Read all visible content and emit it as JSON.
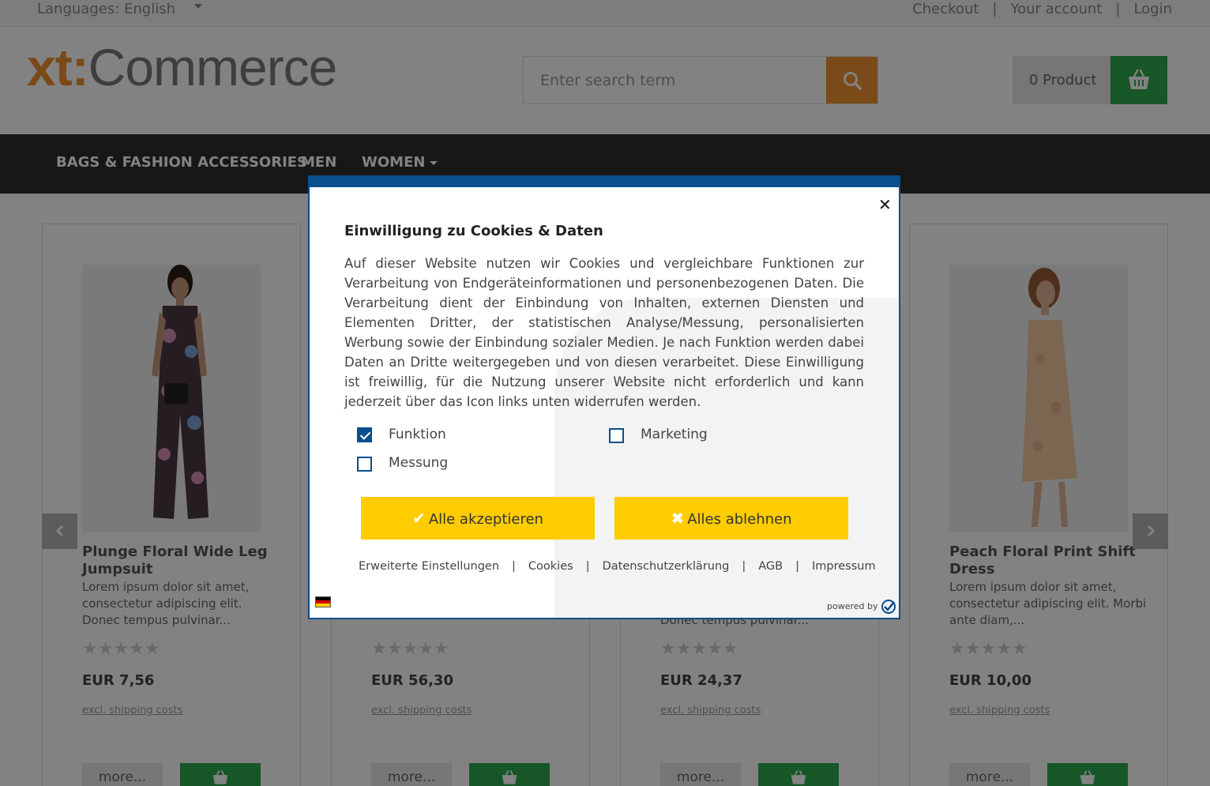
{
  "topbar": {
    "language_label": "Languages: English",
    "links": [
      "Checkout",
      "Your account",
      "Login"
    ]
  },
  "header": {
    "logo_xt": "xt:",
    "logo_commerce": "Commerce",
    "search_placeholder": "Enter search term",
    "cart_label": "0 Product"
  },
  "nav": {
    "items": [
      "BAGS & FASHION ACCESSORIES",
      "MEN",
      "WOMEN"
    ]
  },
  "products": [
    {
      "title": "Plunge Floral Wide Leg Jumpsuit",
      "description": "Lorem ipsum dolor sit amet, consectetur adipiscing elit. Donec tempus pulvinar...",
      "stars": "★★★★★",
      "price": "EUR 7,56",
      "shipping": "excl. shipping costs",
      "more": "more..."
    },
    {
      "title": "",
      "description": "",
      "stars": "★★★★★",
      "price": "EUR 56,30",
      "shipping": "excl. shipping costs",
      "more": "more..."
    },
    {
      "title": "",
      "description": "Donec tempus pulvinar...",
      "stars": "★★★★★",
      "price": "EUR 24,37",
      "shipping": "excl. shipping costs",
      "more": "more..."
    },
    {
      "title": "Peach Floral Print Shift Dress",
      "description": "Lorem ipsum dolor sit amet, consectetur adipiscing elit. Morbi ante diam,...",
      "stars": "★★★★★",
      "price": "EUR 10,00",
      "shipping": "excl. shipping costs",
      "more": "more..."
    }
  ],
  "modal": {
    "close": "✕",
    "title": "Einwilligung zu Cookies & Daten",
    "text": "Auf dieser Website nutzen wir Cookies und vergleichbare Funktionen zur Verarbeitung von Endgeräteinformationen und personenbezogenen Daten. Die Verarbeitung dient der Einbindung von Inhalten, externen Diensten und Elementen Dritter, der statistischen Analyse/Messung, personalisierten Werbung sowie der Einbindung sozialer Medien. Je nach Funktion werden dabei Daten an Dritte weitergegeben und von diesen verarbeitet. Diese Einwilligung ist freiwillig, für die Nutzung unserer Website nicht erforderlich und kann jederzeit über das Icon links unten widerrufen werden.",
    "checkboxes": [
      {
        "label": "Funktion",
        "checked": true
      },
      {
        "label": "Marketing",
        "checked": false
      },
      {
        "label": "Messung",
        "checked": false
      }
    ],
    "accept_label": "Alle akzeptieren",
    "reject_label": "Alles ablehnen",
    "links": [
      "Erweiterte Einstellungen",
      "Cookies",
      "Datenschutzerklärung",
      "AGB",
      "Impressum"
    ],
    "powered_by": "powered by"
  },
  "colors": {
    "brand_orange": "#f29231",
    "cart_green": "#2ba94e",
    "nav_dark": "#2e2e2e",
    "modal_blue": "#0a4e8c",
    "button_yellow": "#ffcc00"
  }
}
